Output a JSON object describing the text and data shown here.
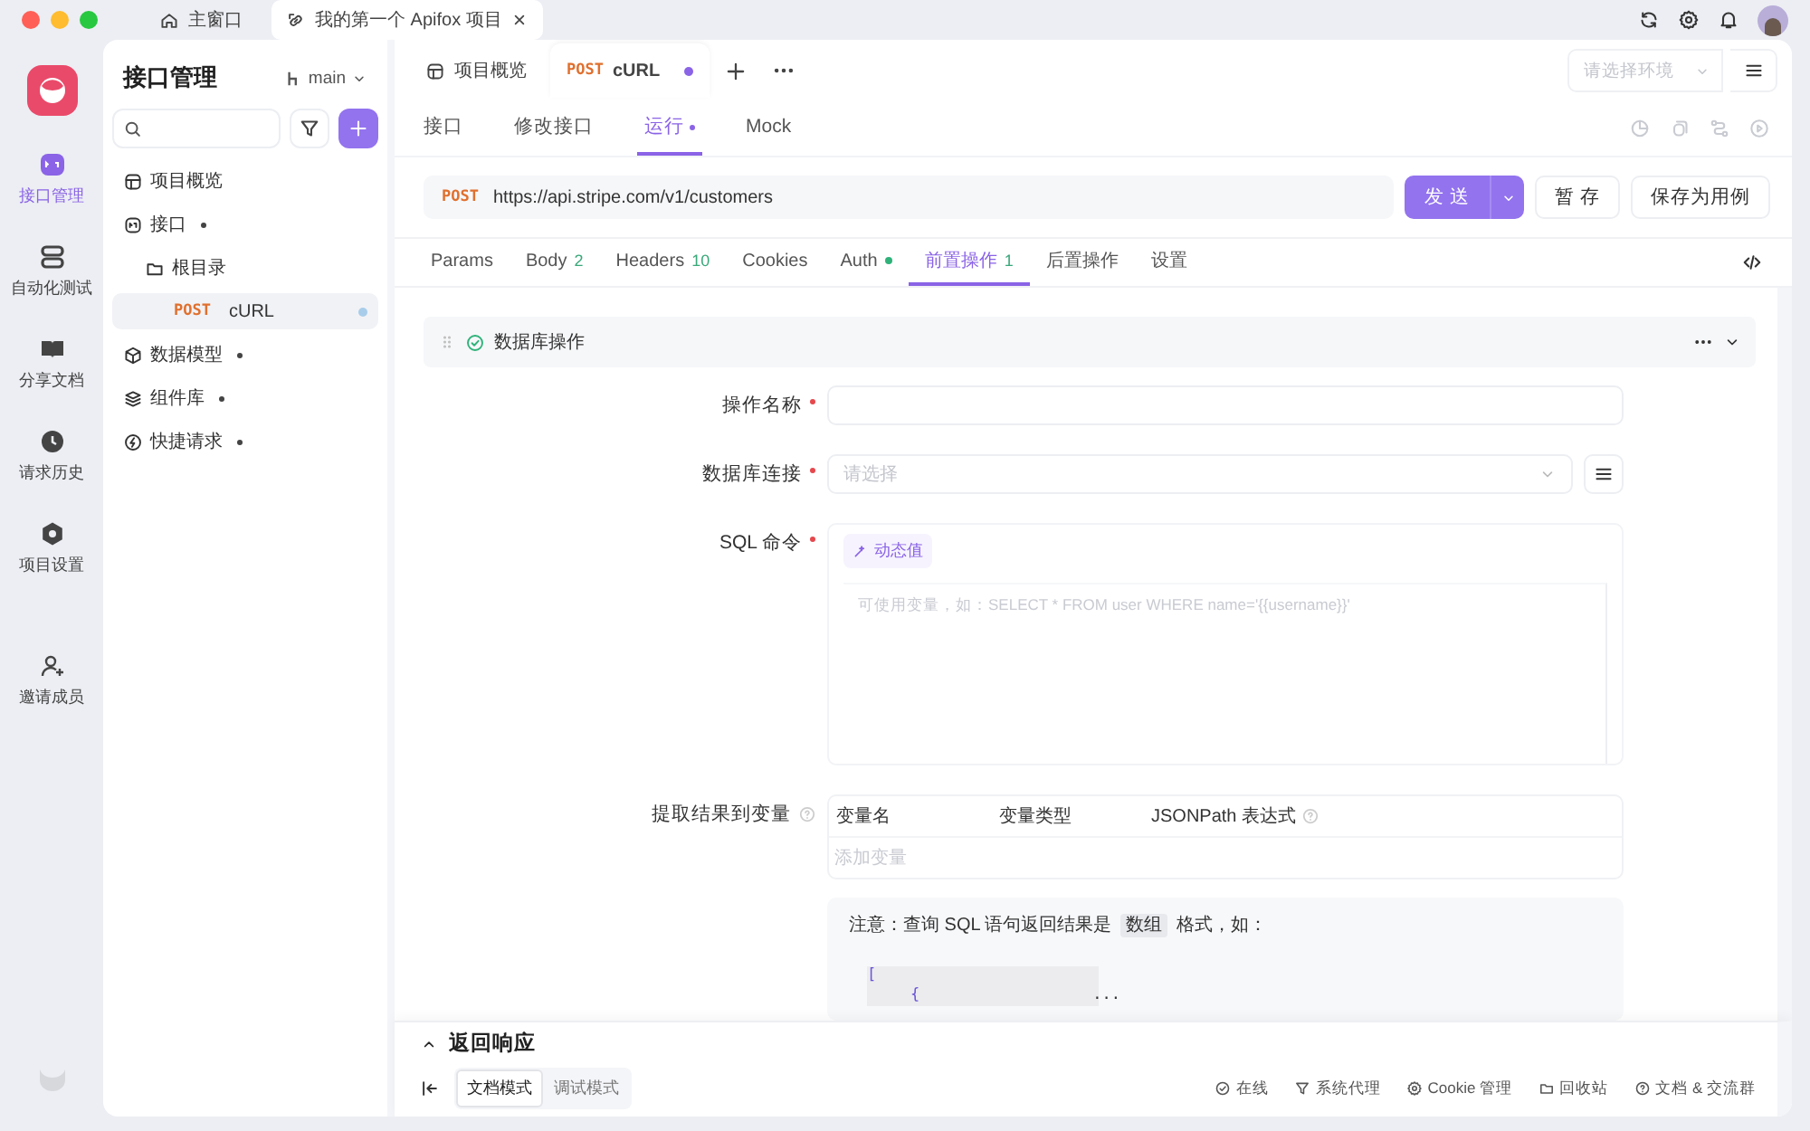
{
  "titlebar": {
    "tabs": [
      {
        "label": "主窗口",
        "kind": "home",
        "selected": false,
        "closable": false
      },
      {
        "label": "我的第一个 Apifox 项目",
        "kind": "project",
        "selected": true,
        "closable": true
      }
    ]
  },
  "rail": {
    "items": [
      {
        "label": "接口管理",
        "selected": true
      },
      {
        "label": "自动化测试",
        "selected": false
      },
      {
        "label": "分享文档",
        "selected": false
      },
      {
        "label": "请求历史",
        "selected": false
      },
      {
        "label": "项目设置",
        "selected": false
      },
      {
        "label": "邀请成员",
        "selected": false
      }
    ]
  },
  "sidebar": {
    "title": "接口管理",
    "branch": "main",
    "tree": [
      {
        "label": "项目概览",
        "kind": "overview",
        "caret": false,
        "selected": false
      },
      {
        "label": "接口",
        "kind": "api",
        "caret": true,
        "selected": false,
        "children": [
          {
            "label": "根目录",
            "kind": "folder",
            "caret": false,
            "selected": false,
            "children": [
              {
                "label": "cURL",
                "kind": "request",
                "method": "POST",
                "caret": false,
                "selected": true,
                "unsaved": true
              }
            ]
          }
        ]
      },
      {
        "label": "数据模型",
        "kind": "model",
        "caret": true,
        "selected": false
      },
      {
        "label": "组件库",
        "kind": "component",
        "caret": true,
        "selected": false
      },
      {
        "label": "快捷请求",
        "kind": "quick",
        "caret": true,
        "selected": false
      }
    ]
  },
  "main": {
    "tabs": [
      {
        "label": "项目概览",
        "kind": "overview",
        "selected": false,
        "unsaved": false
      },
      {
        "label": "cURL",
        "method": "POST",
        "kind": "request",
        "selected": true,
        "unsaved": true
      }
    ],
    "env_placeholder": "请选择环境",
    "subtabs": [
      {
        "label": "接口",
        "selected": false,
        "dot": false
      },
      {
        "label": "修改接口",
        "selected": false,
        "dot": false
      },
      {
        "label": "运行",
        "selected": true,
        "dot": true
      },
      {
        "label": "Mock",
        "selected": false,
        "dot": false
      }
    ],
    "request": {
      "method": "POST",
      "url": "https://api.stripe.com/v1/customers",
      "send": "发 送",
      "save": "暂 存",
      "save_case": "保存为用例"
    },
    "req_tabs": [
      {
        "label": "Params",
        "selected": false
      },
      {
        "label": "Body",
        "count": "2",
        "selected": false
      },
      {
        "label": "Headers",
        "count": "10",
        "selected": false
      },
      {
        "label": "Cookies",
        "selected": false
      },
      {
        "label": "Auth",
        "dot": true,
        "selected": false
      },
      {
        "label": "前置操作",
        "count": "1",
        "selected": true
      },
      {
        "label": "后置操作",
        "selected": false
      },
      {
        "label": "设置",
        "selected": false
      }
    ],
    "operation": {
      "title": "数据库操作",
      "enabled": true,
      "fields": [
        {
          "label": "操作名称",
          "required": true,
          "kind": "input"
        },
        {
          "label": "数据库连接",
          "required": true,
          "kind": "select",
          "placeholder": "请选择"
        },
        {
          "label": "SQL 命令",
          "required": true,
          "kind": "code",
          "chip": "动态值",
          "placeholder": "可使用变量，如：SELECT * FROM user WHERE name='{{username}}'"
        }
      ],
      "extract": {
        "label": "提取结果到变量",
        "columns": [
          "变量名",
          "变量类型",
          "JSONPath 表达式"
        ],
        "add_placeholder": "添加变量"
      },
      "note": {
        "before": "注意：查询 SQL 语句返回结果是",
        "highlight": "数组",
        "after": "格式，如：",
        "code_lines": [
          "[",
          "{"
        ],
        "more": "..."
      }
    }
  },
  "response": {
    "title": "返回响应",
    "modes": [
      {
        "label": "文档模式",
        "selected": true
      },
      {
        "label": "调试模式",
        "selected": false
      }
    ]
  },
  "status_bar": [
    {
      "label": "在线"
    },
    {
      "label": "系统代理"
    },
    {
      "label": "Cookie 管理"
    },
    {
      "label": "回收站"
    },
    {
      "label": "文档 & 交流群"
    }
  ]
}
